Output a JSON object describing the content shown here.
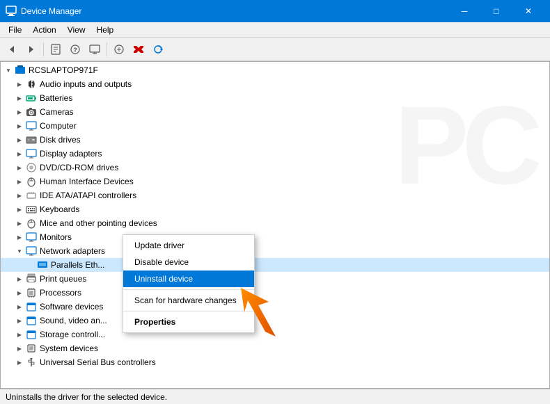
{
  "titleBar": {
    "icon": "🖥",
    "title": "Device Manager",
    "minimize": "─",
    "maximize": "□",
    "close": "✕"
  },
  "menuBar": {
    "items": [
      "File",
      "Action",
      "View",
      "Help"
    ]
  },
  "toolbar": {
    "buttons": [
      {
        "name": "back-btn",
        "icon": "◀",
        "label": "Back"
      },
      {
        "name": "forward-btn",
        "icon": "▶",
        "label": "Forward"
      },
      {
        "name": "show-properties-btn",
        "icon": "🖼",
        "label": "Show properties"
      },
      {
        "name": "update-driver-btn",
        "icon": "📋",
        "label": "Update driver software"
      },
      {
        "name": "help-btn",
        "icon": "❓",
        "label": "Help"
      },
      {
        "name": "display-btn",
        "icon": "🖥",
        "label": "Display devices"
      },
      {
        "name": "add-btn",
        "icon": "➕",
        "label": "Add legacy hardware"
      },
      {
        "name": "remove-btn",
        "icon": "✕",
        "label": "Uninstall device"
      },
      {
        "name": "scan-btn",
        "icon": "🔍",
        "label": "Scan for hardware changes"
      }
    ]
  },
  "tree": {
    "rootLabel": "RCSLAPTOP971F",
    "items": [
      {
        "id": "audio",
        "label": "Audio inputs and outputs",
        "icon": "🔊",
        "indent": 1,
        "expanded": false
      },
      {
        "id": "batteries",
        "label": "Batteries",
        "icon": "🔋",
        "indent": 1,
        "expanded": false
      },
      {
        "id": "cameras",
        "label": "Cameras",
        "icon": "📷",
        "indent": 1,
        "expanded": false
      },
      {
        "id": "computer",
        "label": "Computer",
        "icon": "💻",
        "indent": 1,
        "expanded": false
      },
      {
        "id": "diskdrives",
        "label": "Disk drives",
        "icon": "💾",
        "indent": 1,
        "expanded": false
      },
      {
        "id": "displayadapters",
        "label": "Display adapters",
        "icon": "🖥",
        "indent": 1,
        "expanded": false
      },
      {
        "id": "dvd",
        "label": "DVD/CD-ROM drives",
        "icon": "💿",
        "indent": 1,
        "expanded": false
      },
      {
        "id": "hid",
        "label": "Human Interface Devices",
        "icon": "🖱",
        "indent": 1,
        "expanded": false
      },
      {
        "id": "ide",
        "label": "IDE ATA/ATAPI controllers",
        "icon": "⚙",
        "indent": 1,
        "expanded": false
      },
      {
        "id": "keyboards",
        "label": "Keyboards",
        "icon": "⌨",
        "indent": 1,
        "expanded": false
      },
      {
        "id": "mice",
        "label": "Mice and other pointing devices",
        "icon": "🖱",
        "indent": 1,
        "expanded": false
      },
      {
        "id": "monitors",
        "label": "Monitors",
        "icon": "🖥",
        "indent": 1,
        "expanded": false
      },
      {
        "id": "network",
        "label": "Network adapters",
        "icon": "🌐",
        "indent": 1,
        "expanded": true
      },
      {
        "id": "parallels",
        "label": "Parallels Eth...",
        "icon": "🔗",
        "indent": 2,
        "selected": true
      },
      {
        "id": "printqueues",
        "label": "Print queues",
        "icon": "🖨",
        "indent": 1,
        "expanded": false
      },
      {
        "id": "processors",
        "label": "Processors",
        "icon": "⚙",
        "indent": 1,
        "expanded": false
      },
      {
        "id": "software",
        "label": "Software devices",
        "icon": "📁",
        "indent": 1,
        "expanded": false
      },
      {
        "id": "sound",
        "label": "Sound, video an...",
        "icon": "📁",
        "indent": 1,
        "expanded": false
      },
      {
        "id": "storage",
        "label": "Storage controll...",
        "icon": "📁",
        "indent": 1,
        "expanded": false
      },
      {
        "id": "system",
        "label": "System devices",
        "icon": "⚙",
        "indent": 1,
        "expanded": false
      },
      {
        "id": "usb",
        "label": "Universal Serial Bus controllers",
        "icon": "🔌",
        "indent": 1,
        "expanded": false
      }
    ]
  },
  "contextMenu": {
    "items": [
      {
        "id": "update-driver",
        "label": "Update driver",
        "type": "item"
      },
      {
        "id": "disable-device",
        "label": "Disable device",
        "type": "item"
      },
      {
        "id": "uninstall-device",
        "label": "Uninstall device",
        "type": "item",
        "active": true
      },
      {
        "id": "sep1",
        "type": "separator"
      },
      {
        "id": "scan",
        "label": "Scan for hardware changes",
        "type": "item"
      },
      {
        "id": "sep2",
        "type": "separator"
      },
      {
        "id": "properties",
        "label": "Properties",
        "type": "item",
        "bold": true
      }
    ]
  },
  "statusBar": {
    "text": "Uninstalls the driver for the selected device."
  }
}
